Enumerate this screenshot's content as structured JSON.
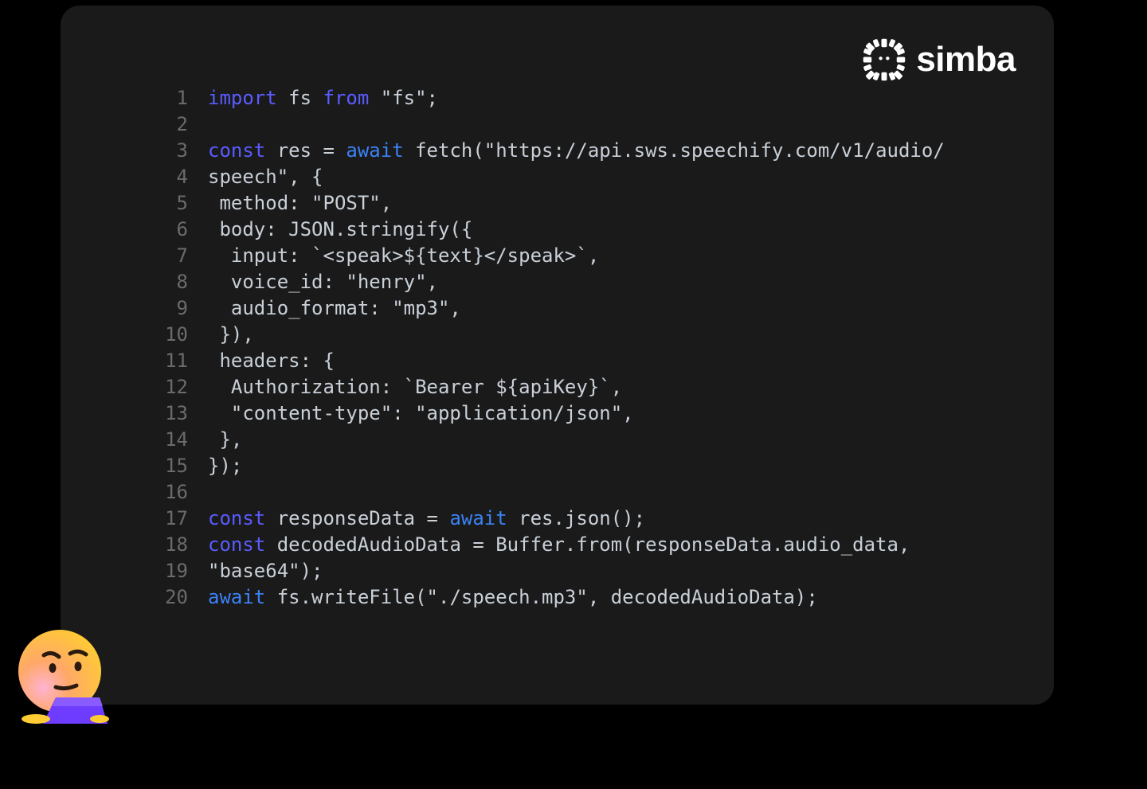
{
  "brand": {
    "name": "simba"
  },
  "code": {
    "lines": [
      {
        "n": "1",
        "tokens": [
          {
            "t": "import",
            "c": "kw"
          },
          {
            "t": " fs ",
            "c": ""
          },
          {
            "t": "from",
            "c": "kw"
          },
          {
            "t": " \"fs\";",
            "c": ""
          }
        ]
      },
      {
        "n": "2",
        "tokens": [
          {
            "t": "",
            "c": ""
          }
        ]
      },
      {
        "n": "3",
        "tokens": [
          {
            "t": "const",
            "c": "kw"
          },
          {
            "t": " res = ",
            "c": ""
          },
          {
            "t": "await",
            "c": "kw2"
          },
          {
            "t": " fetch(\"https://api.sws.speechify.com/v1/audio/",
            "c": ""
          }
        ]
      },
      {
        "n": "4",
        "tokens": [
          {
            "t": "speech\", {",
            "c": ""
          }
        ]
      },
      {
        "n": "5",
        "tokens": [
          {
            "t": " method: \"POST\",",
            "c": ""
          }
        ]
      },
      {
        "n": "6",
        "tokens": [
          {
            "t": " body: JSON.stringify({",
            "c": ""
          }
        ]
      },
      {
        "n": "7",
        "tokens": [
          {
            "t": "  input: `<speak>${text}</speak>`,",
            "c": ""
          }
        ]
      },
      {
        "n": "8",
        "tokens": [
          {
            "t": "  voice_id: \"henry\",",
            "c": ""
          }
        ]
      },
      {
        "n": "9",
        "tokens": [
          {
            "t": "  audio_format: \"mp3\",",
            "c": ""
          }
        ]
      },
      {
        "n": "10",
        "tokens": [
          {
            "t": " }),",
            "c": ""
          }
        ]
      },
      {
        "n": "11",
        "tokens": [
          {
            "t": " headers: {",
            "c": ""
          }
        ]
      },
      {
        "n": "12",
        "tokens": [
          {
            "t": "  Authorization: `Bearer ${apiKey}`,",
            "c": ""
          }
        ]
      },
      {
        "n": "13",
        "tokens": [
          {
            "t": "  \"content-type\": \"application/json\",",
            "c": ""
          }
        ]
      },
      {
        "n": "14",
        "tokens": [
          {
            "t": " },",
            "c": ""
          }
        ]
      },
      {
        "n": "15",
        "tokens": [
          {
            "t": "});",
            "c": ""
          }
        ]
      },
      {
        "n": "16",
        "tokens": [
          {
            "t": "",
            "c": ""
          }
        ]
      },
      {
        "n": "17",
        "tokens": [
          {
            "t": "const",
            "c": "kw"
          },
          {
            "t": " responseData = ",
            "c": ""
          },
          {
            "t": "await",
            "c": "kw2"
          },
          {
            "t": " res.json();",
            "c": ""
          }
        ]
      },
      {
        "n": "18",
        "tokens": [
          {
            "t": "const",
            "c": "kw"
          },
          {
            "t": " decodedAudioData = Buffer.from(responseData.audio_data, ",
            "c": ""
          }
        ]
      },
      {
        "n": "19",
        "tokens": [
          {
            "t": "\"base64\");",
            "c": ""
          }
        ]
      },
      {
        "n": "20",
        "tokens": [
          {
            "t": "await",
            "c": "kw2"
          },
          {
            "t": " fs.writeFile(\"./speech.mp3\", decodedAudioData);",
            "c": ""
          }
        ]
      }
    ]
  }
}
